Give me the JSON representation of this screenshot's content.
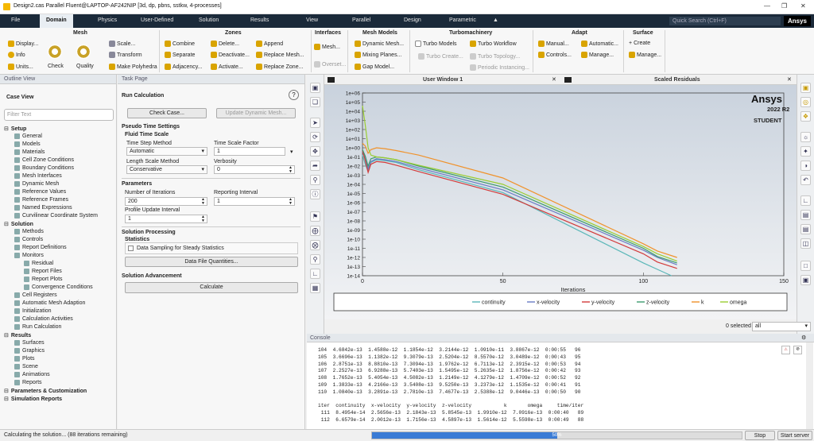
{
  "window": {
    "title": "Design2.cas Parallel Fluent@LAPTOP-AF242NIP  [3d, dp, pbns, sstkw, 4-processes]",
    "min": "—",
    "max": "☐",
    "close": "✕",
    "restore": "❐"
  },
  "menu": {
    "tabs": [
      "File",
      "Domain",
      "Physics",
      "User-Defined",
      "Solution",
      "Results",
      "View",
      "Parallel",
      "Design",
      "Parametric"
    ],
    "active": "Domain",
    "search_placeholder": "Quick Search (Ctrl+F)",
    "brand": "Ansys"
  },
  "ribbon": {
    "mesh": {
      "title": "Mesh",
      "display": "Display...",
      "info": "Info",
      "units": "Units...",
      "check": "Check",
      "quality": "Quality",
      "scale": "Scale...",
      "transform": "Transform",
      "polyhedra": "Make Polyhedra"
    },
    "zones": {
      "title": "Zones",
      "combine": "Combine",
      "separate": "Separate",
      "adjacency": "Adjacency...",
      "delete": "Delete...",
      "deactivate": "Deactivate...",
      "activate": "Activate...",
      "append": "Append",
      "replace_mesh": "Replace Mesh...",
      "replace_zone": "Replace Zone..."
    },
    "interfaces": {
      "title": "Interfaces",
      "mesh": "Mesh...",
      "overset": "Overset..."
    },
    "mesh_models": {
      "title": "Mesh Models",
      "dynamic": "Dynamic Mesh...",
      "mixing": "Mixing Planes...",
      "gap": "Gap Model..."
    },
    "turbo": {
      "title": "Turbomachinery",
      "models": "Turbo Models",
      "create": "Turbo Create...",
      "workflow": "Turbo Workflow",
      "topology": "Turbo Topology...",
      "periodic": "Periodic Instancing..."
    },
    "adapt": {
      "title": "Adapt",
      "manual": "Manual...",
      "automatic": "Automatic...",
      "controls": "Controls...",
      "manage": "Manage..."
    },
    "surface": {
      "title": "Surface",
      "create": "Create",
      "manage": "Manage..."
    }
  },
  "outline": {
    "header": "Outline View",
    "case_view": "Case View",
    "filter_placeholder": "Filter Text",
    "items": [
      {
        "label": "Setup",
        "level": 0,
        "bold": true
      },
      {
        "label": "General",
        "level": 2
      },
      {
        "label": "Models",
        "level": 2
      },
      {
        "label": "Materials",
        "level": 2
      },
      {
        "label": "Cell Zone Conditions",
        "level": 2
      },
      {
        "label": "Boundary Conditions",
        "level": 2
      },
      {
        "label": "Mesh Interfaces",
        "level": 2
      },
      {
        "label": "Dynamic Mesh",
        "level": 2
      },
      {
        "label": "Reference Values",
        "level": 2
      },
      {
        "label": "Reference Frames",
        "level": 2
      },
      {
        "label": "Named Expressions",
        "level": 2
      },
      {
        "label": "Curvilinear Coordinate System",
        "level": 2
      },
      {
        "label": "Solution",
        "level": 0,
        "bold": true
      },
      {
        "label": "Methods",
        "level": 2
      },
      {
        "label": "Controls",
        "level": 2
      },
      {
        "label": "Report Definitions",
        "level": 2
      },
      {
        "label": "Monitors",
        "level": 2
      },
      {
        "label": "Residual",
        "level": 3
      },
      {
        "label": "Report Files",
        "level": 3
      },
      {
        "label": "Report Plots",
        "level": 3
      },
      {
        "label": "Convergence Conditions",
        "level": 3
      },
      {
        "label": "Cell Registers",
        "level": 2
      },
      {
        "label": "Automatic Mesh Adaption",
        "level": 2
      },
      {
        "label": "Initialization",
        "level": 2
      },
      {
        "label": "Calculation Activities",
        "level": 2
      },
      {
        "label": "Run Calculation",
        "level": 2
      },
      {
        "label": "Results",
        "level": 0,
        "bold": true
      },
      {
        "label": "Surfaces",
        "level": 2
      },
      {
        "label": "Graphics",
        "level": 2
      },
      {
        "label": "Plots",
        "level": 2
      },
      {
        "label": "Scene",
        "level": 2
      },
      {
        "label": "Animations",
        "level": 2
      },
      {
        "label": "Reports",
        "level": 2
      },
      {
        "label": "Parameters & Customization",
        "level": 0,
        "bold": true
      },
      {
        "label": "Simulation Reports",
        "level": 0,
        "bold": true
      }
    ]
  },
  "task": {
    "header": "Task Page",
    "title": "Run Calculation",
    "check_case": "Check Case...",
    "update_dynamic": "Update Dynamic Mesh...",
    "pseudo_title": "Pseudo Time Settings",
    "fluid_scale": "Fluid Time Scale",
    "time_step_method_label": "Time Step Method",
    "time_step_method": "Automatic",
    "time_scale_factor_label": "Time Scale Factor",
    "time_scale_factor": "1",
    "length_scale_method_label": "Length Scale Method",
    "length_scale_method": "Conservative",
    "verbosity_label": "Verbosity",
    "verbosity": "0",
    "parameters_title": "Parameters",
    "iterations_label": "Number of Iterations",
    "iterations": "200",
    "reporting_label": "Reporting Interval",
    "reporting": "1",
    "profile_label": "Profile Update Interval",
    "profile": "1",
    "processing_title": "Solution Processing",
    "statistics_title": "Statistics",
    "data_sampling": "Data Sampling for Steady Statistics",
    "data_file": "Data File Quantities...",
    "advancement_title": "Solution Advancement",
    "calculate": "Calculate"
  },
  "graphics": {
    "tab1": "User Window 1",
    "tab2": "Scaled Residuals",
    "brand_main": "Ansys",
    "brand_version": "2022 R2",
    "brand_student": "STUDENT",
    "selected_label": "0 selected",
    "selected_filter": "all"
  },
  "chart_data": {
    "type": "line",
    "xlabel": "Iterations",
    "ylabel": "",
    "xlim": [
      0,
      150
    ],
    "ylim": [
      -14,
      6
    ],
    "log_scale_y": true,
    "x_ticks": [
      "0",
      "50",
      "100",
      "150"
    ],
    "y_ticks": [
      "1e+06",
      "1e+05",
      "1e+04",
      "1e+03",
      "1e+02",
      "1e+01",
      "1e+00",
      "1e-01",
      "1e-02",
      "1e-03",
      "1e-04",
      "1e-05",
      "1e-06",
      "1e-07",
      "1e-08",
      "1e-09",
      "1e-10",
      "1e-11",
      "1e-12",
      "1e-13",
      "1e-14"
    ],
    "series": [
      {
        "name": "continuity",
        "color": "#5ab7b8",
        "points": [
          [
            0,
            -0.8
          ],
          [
            1,
            -1.8
          ],
          [
            2,
            -2.6
          ],
          [
            3,
            -1.6
          ],
          [
            5,
            -1.3
          ],
          [
            8,
            -1.4
          ],
          [
            12,
            -1.6
          ],
          [
            20,
            -2.4
          ],
          [
            50,
            -4.9
          ],
          [
            100,
            -12.6
          ],
          [
            105,
            -13.3
          ],
          [
            110,
            -14.0
          ]
        ]
      },
      {
        "name": "x-velocity",
        "color": "#6a7cc4",
        "points": [
          [
            0,
            -0.4
          ],
          [
            1,
            -1.0
          ],
          [
            2,
            -2.3
          ],
          [
            3,
            -1.5
          ],
          [
            5,
            -1.2
          ],
          [
            8,
            -1.3
          ],
          [
            12,
            -1.5
          ],
          [
            20,
            -2.2
          ],
          [
            50,
            -4.6
          ],
          [
            100,
            -11.2
          ],
          [
            105,
            -12.0
          ],
          [
            112,
            -12.8
          ]
        ]
      },
      {
        "name": "y-velocity",
        "color": "#d33b3b",
        "points": [
          [
            0,
            -0.3
          ],
          [
            1,
            -1.4
          ],
          [
            2,
            -2.7
          ],
          [
            3,
            -1.8
          ],
          [
            5,
            -1.5
          ],
          [
            8,
            -1.6
          ],
          [
            12,
            -1.9
          ],
          [
            20,
            -2.6
          ],
          [
            50,
            -5.1
          ],
          [
            100,
            -11.6
          ],
          [
            105,
            -12.5
          ],
          [
            112,
            -13.2
          ]
        ]
      },
      {
        "name": "z-velocity",
        "color": "#3d9b6e",
        "points": [
          [
            0,
            -0.2
          ],
          [
            1,
            -0.9
          ],
          [
            2,
            -2.0
          ],
          [
            3,
            -1.2
          ],
          [
            5,
            -1.0
          ],
          [
            8,
            -1.1
          ],
          [
            12,
            -1.3
          ],
          [
            20,
            -2.0
          ],
          [
            50,
            -4.3
          ],
          [
            100,
            -11.0
          ],
          [
            105,
            -11.9
          ],
          [
            112,
            -12.6
          ]
        ]
      },
      {
        "name": "k",
        "color": "#f0922b",
        "points": [
          [
            0,
            0.5
          ],
          [
            1,
            0.2
          ],
          [
            2,
            -0.6
          ],
          [
            3,
            -0.2
          ],
          [
            5,
            0.0
          ],
          [
            8,
            -0.1
          ],
          [
            12,
            -0.3
          ],
          [
            20,
            -0.8
          ],
          [
            50,
            -3.3
          ],
          [
            100,
            -10.5
          ],
          [
            105,
            -11.3
          ],
          [
            112,
            -12.0
          ]
        ]
      },
      {
        "name": "omega",
        "color": "#9acd32",
        "points": [
          [
            0,
            4.6
          ],
          [
            1,
            2.5
          ],
          [
            2,
            0.0
          ],
          [
            3,
            -0.8
          ],
          [
            5,
            -1.0
          ],
          [
            8,
            -1.1
          ],
          [
            12,
            -1.3
          ],
          [
            20,
            -1.9
          ],
          [
            50,
            -4.0
          ],
          [
            100,
            -10.8
          ],
          [
            105,
            -11.6
          ],
          [
            112,
            -12.4
          ]
        ]
      }
    ]
  },
  "console": {
    "header": "Console",
    "lines": [
      "104  4.6842e-13  1.4588e-12  1.1854e-12  3.2144e-12  1.0910e-11  3.8867e-12  0:00:55   96",
      "105  3.6696e-13  1.1382e-12  9.3079e-13  2.5204e-12  8.5570e-12  3.0489e-12  0:00:43   95",
      "106  2.8751e-13  8.8810e-13  7.3094e-13  1.9762e-12  6.7113e-12  2.3915e-12  0:00:53   94",
      "107  2.2527e-13  6.9288e-13  5.7403e-13  1.5495e-12  5.2635e-12  1.8756e-12  0:00:42   93",
      "108  1.7652e-13  5.4054e-13  4.5082e-13  1.2149e-12  4.1279e-12  1.4709e-12  0:00:52   92",
      "109  1.3833e-13  4.2166e-13  3.5408e-13  9.5250e-13  3.2373e-12  1.1535e-12  0:00:41   91",
      "110  1.0840e-13  3.2891e-13  2.7810e-13  7.4677e-13  2.5388e-12  9.0446e-13  0:00:50   90",
      "",
      "iter  continuity  x-velocity  y-velocity  z-velocity           k       omega     time/iter",
      " 111  8.4954e-14  2.5656e-13  2.1843e-13  5.8545e-13  1.9910e-12  7.0916e-13  0:00:40   89",
      " 112  6.6579e-14  2.0012e-13  1.7156e-13  4.5897e-13  1.5614e-12  5.5598e-13  0:00:49   88"
    ]
  },
  "status": {
    "text": "Calculating the solution... (88 iterations remaining)",
    "progress": 0.5,
    "progress_label": "50%",
    "stop": "Stop",
    "start_server": "Start server"
  }
}
